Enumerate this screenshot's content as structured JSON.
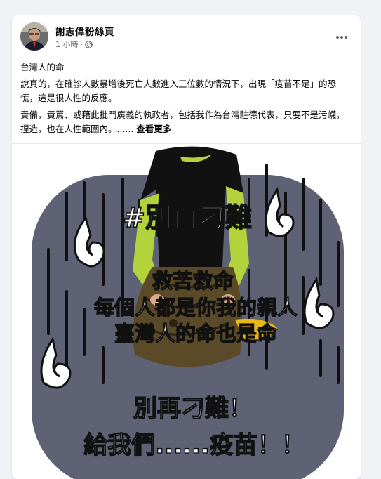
{
  "post": {
    "author": "謝志偉粉絲頁",
    "time": "1 小時",
    "separator": "·",
    "more_icon": "more-horizontal-icon",
    "privacy_icon": "globe-icon",
    "title": "台灣人的命",
    "paragraph1": "說真的，在確診人數暴增後死亡人數進入三位數的情況下，出現「疫苗不足」的恐慌，這是很人性的反應。",
    "paragraph2": "責備，責罵、或藉此批鬥廣義的執政者，包括我作為台灣駐德代表，只要不是污衊，捏造，也在人性範圍內。......",
    "see_more": "查看更多"
  },
  "image": {
    "hashtag": "#別再刁難",
    "line1": "救苦救命",
    "line2": "每個人都是你我的親人",
    "line3": "臺灣人的命也是命",
    "line4": "別再刁難！",
    "line5": "給我們......疫苗！！",
    "colors": {
      "background": "#5f6275",
      "rain": "#111111",
      "text": "#ffffff",
      "shirt": "#111111",
      "sleeve": "#b4d23c",
      "pants": "#5a4a28",
      "shoe": "#e8b81a"
    }
  }
}
